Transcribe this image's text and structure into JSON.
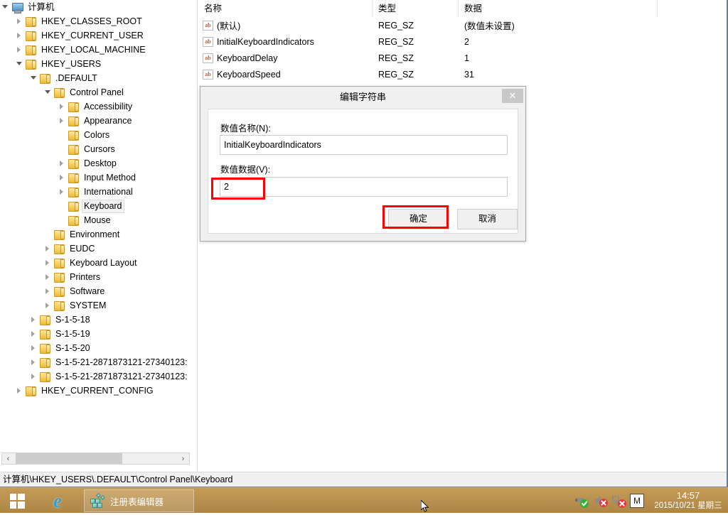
{
  "window": {
    "title": "注册表编辑器",
    "status_path": "计算机\\HKEY_USERS\\.DEFAULT\\Control Panel\\Keyboard"
  },
  "tree": {
    "root": {
      "label": "计算机",
      "icon": "computer-icon",
      "expanded": true
    },
    "nodes": [
      {
        "label": "HKEY_CLASSES_ROOT",
        "depth": 1,
        "state": "collapsed",
        "selected": false
      },
      {
        "label": "HKEY_CURRENT_USER",
        "depth": 1,
        "state": "collapsed",
        "selected": false
      },
      {
        "label": "HKEY_LOCAL_MACHINE",
        "depth": 1,
        "state": "collapsed",
        "selected": false
      },
      {
        "label": "HKEY_USERS",
        "depth": 1,
        "state": "expanded",
        "selected": false
      },
      {
        "label": ".DEFAULT",
        "depth": 2,
        "state": "expanded",
        "selected": false
      },
      {
        "label": "Control Panel",
        "depth": 3,
        "state": "expanded",
        "selected": false
      },
      {
        "label": "Accessibility",
        "depth": 4,
        "state": "collapsed",
        "selected": false
      },
      {
        "label": "Appearance",
        "depth": 4,
        "state": "collapsed",
        "selected": false
      },
      {
        "label": "Colors",
        "depth": 4,
        "state": "leaf",
        "selected": false
      },
      {
        "label": "Cursors",
        "depth": 4,
        "state": "leaf",
        "selected": false
      },
      {
        "label": "Desktop",
        "depth": 4,
        "state": "collapsed",
        "selected": false
      },
      {
        "label": "Input Method",
        "depth": 4,
        "state": "collapsed",
        "selected": false
      },
      {
        "label": "International",
        "depth": 4,
        "state": "collapsed",
        "selected": false
      },
      {
        "label": "Keyboard",
        "depth": 4,
        "state": "leaf",
        "selected": true
      },
      {
        "label": "Mouse",
        "depth": 4,
        "state": "leaf",
        "selected": false
      },
      {
        "label": "Environment",
        "depth": 3,
        "state": "leaf",
        "selected": false
      },
      {
        "label": "EUDC",
        "depth": 3,
        "state": "collapsed",
        "selected": false
      },
      {
        "label": "Keyboard Layout",
        "depth": 3,
        "state": "collapsed",
        "selected": false
      },
      {
        "label": "Printers",
        "depth": 3,
        "state": "collapsed",
        "selected": false
      },
      {
        "label": "Software",
        "depth": 3,
        "state": "collapsed",
        "selected": false
      },
      {
        "label": "SYSTEM",
        "depth": 3,
        "state": "collapsed",
        "selected": false
      },
      {
        "label": "S-1-5-18",
        "depth": 2,
        "state": "collapsed",
        "selected": false
      },
      {
        "label": "S-1-5-19",
        "depth": 2,
        "state": "collapsed",
        "selected": false
      },
      {
        "label": "S-1-5-20",
        "depth": 2,
        "state": "collapsed",
        "selected": false
      },
      {
        "label": "S-1-5-21-2871873121-27340123:",
        "depth": 2,
        "state": "collapsed",
        "selected": false
      },
      {
        "label": "S-1-5-21-2871873121-27340123:",
        "depth": 2,
        "state": "collapsed",
        "selected": false
      },
      {
        "label": "HKEY_CURRENT_CONFIG",
        "depth": 1,
        "state": "collapsed",
        "selected": false
      }
    ]
  },
  "list": {
    "columns": [
      "名称",
      "类型",
      "数据"
    ],
    "rows": [
      {
        "name": "(默认)",
        "type": "REG_SZ",
        "data": "(数值未设置)"
      },
      {
        "name": "InitialKeyboardIndicators",
        "type": "REG_SZ",
        "data": "2"
      },
      {
        "name": "KeyboardDelay",
        "type": "REG_SZ",
        "data": "1"
      },
      {
        "name": "KeyboardSpeed",
        "type": "REG_SZ",
        "data": "31"
      }
    ],
    "value_icon": "ab-string-icon"
  },
  "dialog": {
    "title": "编辑字符串",
    "close_glyph": "✕",
    "name_label": "数值名称(N):",
    "name_value": "InitialKeyboardIndicators",
    "data_label": "数值数据(V):",
    "data_value": "2",
    "ok_label": "确定",
    "cancel_label": "取消",
    "highlight_color": "#ff0000"
  },
  "taskbar": {
    "start_icon": "windows-logo-icon",
    "ie_icon": "internet-explorer-icon",
    "ie_glyph": "e",
    "task_label": "注册表编辑器",
    "tray": {
      "icons": [
        "usb-safely-remove-icon",
        "volume-muted-icon",
        "network-disconnected-icon",
        "input-method-m-icon"
      ],
      "input_method_glyph": "M",
      "time": "14:57",
      "date": "2015/10/21 星期三"
    }
  },
  "scrollbars": {
    "tree_h_left_arrow": "‹",
    "tree_h_right_arrow": "›"
  }
}
